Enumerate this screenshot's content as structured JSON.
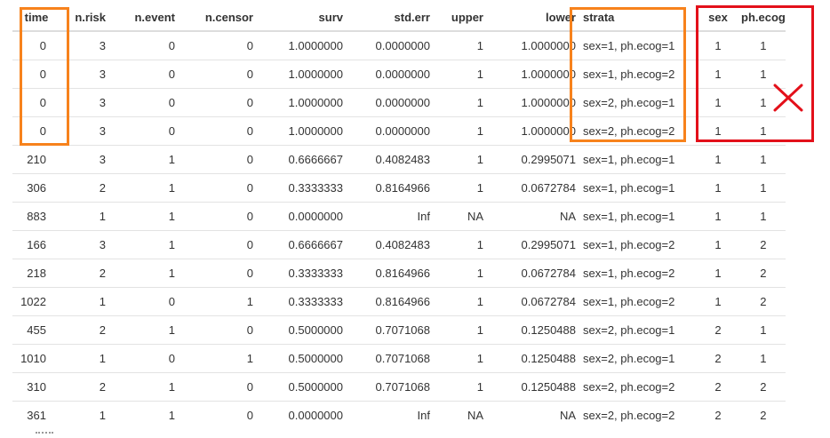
{
  "table": {
    "headers": [
      "time",
      "n.risk",
      "n.event",
      "n.censor",
      "surv",
      "std.err",
      "upper",
      "lower",
      "strata",
      "sex",
      "ph.ecog"
    ],
    "rows": [
      [
        "0",
        "3",
        "0",
        "0",
        "1.0000000",
        "0.0000000",
        "1",
        "1.0000000",
        "sex=1, ph.ecog=1",
        "1",
        "1"
      ],
      [
        "0",
        "3",
        "0",
        "0",
        "1.0000000",
        "0.0000000",
        "1",
        "1.0000000",
        "sex=1, ph.ecog=2",
        "1",
        "1"
      ],
      [
        "0",
        "3",
        "0",
        "0",
        "1.0000000",
        "0.0000000",
        "1",
        "1.0000000",
        "sex=2, ph.ecog=1",
        "1",
        "1"
      ],
      [
        "0",
        "3",
        "0",
        "0",
        "1.0000000",
        "0.0000000",
        "1",
        "1.0000000",
        "sex=2, ph.ecog=2",
        "1",
        "1"
      ],
      [
        "210",
        "3",
        "1",
        "0",
        "0.6666667",
        "0.4082483",
        "1",
        "0.2995071",
        "sex=1, ph.ecog=1",
        "1",
        "1"
      ],
      [
        "306",
        "2",
        "1",
        "0",
        "0.3333333",
        "0.8164966",
        "1",
        "0.0672784",
        "sex=1, ph.ecog=1",
        "1",
        "1"
      ],
      [
        "883",
        "1",
        "1",
        "0",
        "0.0000000",
        "Inf",
        "NA",
        "NA",
        "sex=1, ph.ecog=1",
        "1",
        "1"
      ],
      [
        "166",
        "3",
        "1",
        "0",
        "0.6666667",
        "0.4082483",
        "1",
        "0.2995071",
        "sex=1, ph.ecog=2",
        "1",
        "2"
      ],
      [
        "218",
        "2",
        "1",
        "0",
        "0.3333333",
        "0.8164966",
        "1",
        "0.0672784",
        "sex=1, ph.ecog=2",
        "1",
        "2"
      ],
      [
        "1022",
        "1",
        "0",
        "1",
        "0.3333333",
        "0.8164966",
        "1",
        "0.0672784",
        "sex=1, ph.ecog=2",
        "1",
        "2"
      ],
      [
        "455",
        "2",
        "1",
        "0",
        "0.5000000",
        "0.7071068",
        "1",
        "0.1250488",
        "sex=2, ph.ecog=1",
        "2",
        "1"
      ],
      [
        "1010",
        "1",
        "0",
        "1",
        "0.5000000",
        "0.7071068",
        "1",
        "0.1250488",
        "sex=2, ph.ecog=1",
        "2",
        "1"
      ],
      [
        "310",
        "2",
        "1",
        "0",
        "0.5000000",
        "0.7071068",
        "1",
        "0.1250488",
        "sex=2, ph.ecog=2",
        "2",
        "2"
      ],
      [
        "361",
        "1",
        "1",
        "0",
        "0.0000000",
        "Inf",
        "NA",
        "NA",
        "sex=2, ph.ecog=2",
        "2",
        "2"
      ]
    ]
  },
  "annotations": {
    "highlight_color": "#f7821c",
    "reject_color": "#e3101a",
    "cross_icon": "x-mark-icon"
  }
}
